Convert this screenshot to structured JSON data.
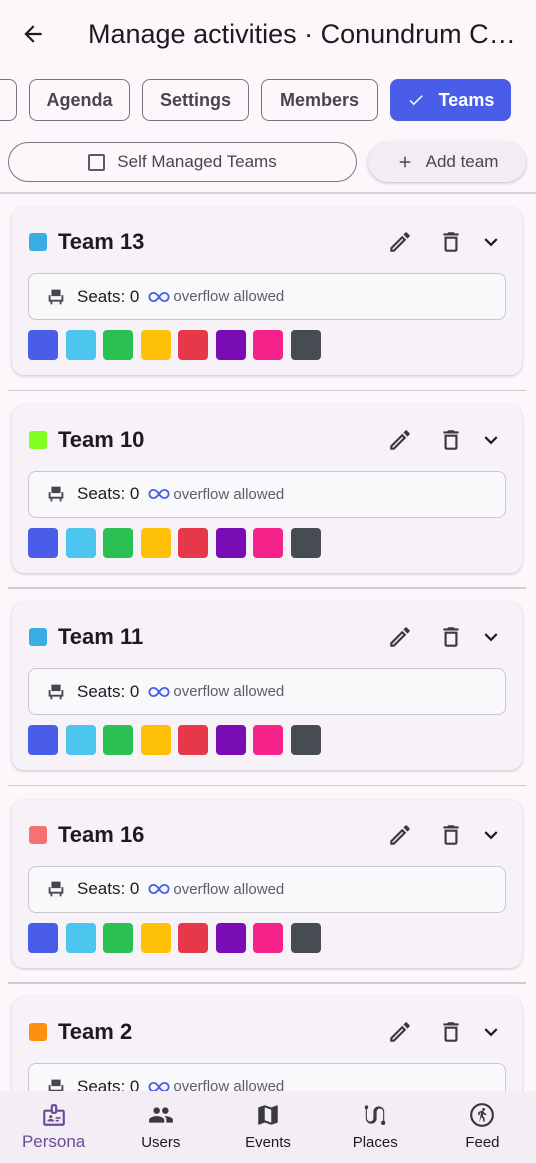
{
  "appbar": {
    "title": "Manage activities · Conundrum Challenge"
  },
  "tabs": [
    {
      "label": ""
    },
    {
      "label": "Agenda"
    },
    {
      "label": "Settings"
    },
    {
      "label": "Members"
    },
    {
      "label": "Teams"
    }
  ],
  "actions": {
    "self_managed": "Self Managed Teams",
    "add_team": "Add team"
  },
  "seats_label": "Seats: 0",
  "overflow_label": "overflow allowed",
  "palette": [
    "#4a5de8",
    "#4cc6ee",
    "#2bc152",
    "#fec107",
    "#e7384a",
    "#7a0cb6",
    "#f5228a",
    "#464c52"
  ],
  "teams": [
    {
      "name": "Team 13",
      "color": "#3aaee2"
    },
    {
      "name": "Team 10",
      "color": "#7fff1f"
    },
    {
      "name": "Team 11",
      "color": "#3aaee2"
    },
    {
      "name": "Team 16",
      "color": "#f67272"
    },
    {
      "name": "Team 2",
      "color": "#fd900f"
    }
  ],
  "nav": [
    {
      "label": "Persona",
      "icon": "persona-badge-icon",
      "active": true
    },
    {
      "label": "Users",
      "icon": "users-icon",
      "active": false
    },
    {
      "label": "Events",
      "icon": "map-icon",
      "active": false
    },
    {
      "label": "Places",
      "icon": "route-icon",
      "active": false
    },
    {
      "label": "Feed",
      "icon": "running-icon",
      "active": false
    }
  ]
}
